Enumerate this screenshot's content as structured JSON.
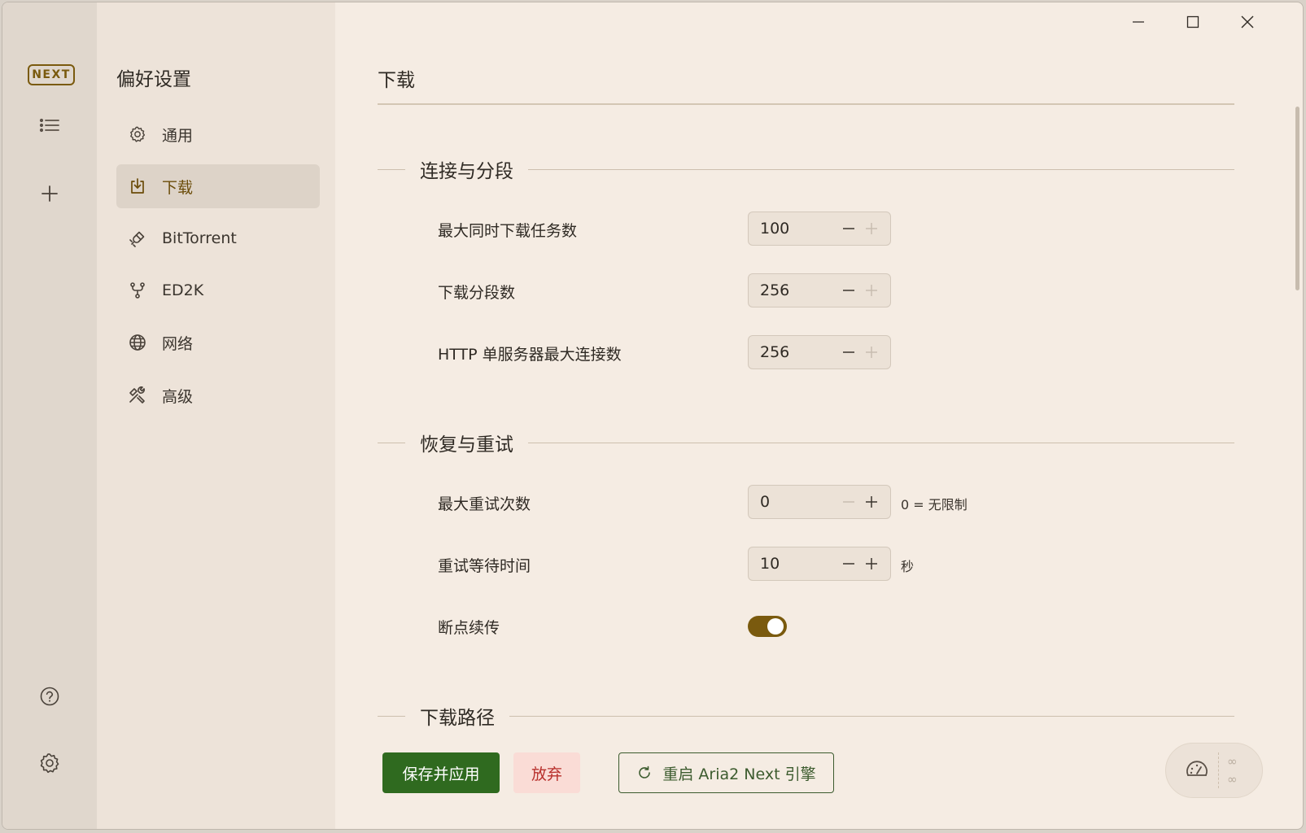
{
  "app": {
    "logo_text": "NEXT",
    "accent_color": "#7a5a0e",
    "primary_color": "#2f6a1f",
    "danger_color": "#b8302c"
  },
  "rail": {
    "icons": [
      "list-icon",
      "plus-icon",
      "help-icon",
      "gear-icon"
    ]
  },
  "sidebar": {
    "title": "偏好设置",
    "items": [
      {
        "label": "通用",
        "icon": "gear-icon",
        "active": false
      },
      {
        "label": "下载",
        "icon": "download-icon",
        "active": true
      },
      {
        "label": "BitTorrent",
        "icon": "magnet-icon",
        "active": false
      },
      {
        "label": "ED2K",
        "icon": "fork-icon",
        "active": false
      },
      {
        "label": "网络",
        "icon": "globe-icon",
        "active": false
      },
      {
        "label": "高级",
        "icon": "tools-icon",
        "active": false
      }
    ]
  },
  "main": {
    "title": "下载",
    "sections": {
      "connection": {
        "title": "连接与分段",
        "max_concurrent": {
          "label": "最大同时下载任务数",
          "value": "100"
        },
        "split": {
          "label": "下载分段数",
          "value": "256"
        },
        "max_conn_per_server": {
          "label": "HTTP 单服务器最大连接数",
          "value": "256"
        }
      },
      "retry": {
        "title": "恢复与重试",
        "max_tries": {
          "label": "最大重试次数",
          "value": "0",
          "suffix": "0 = 无限制"
        },
        "retry_wait": {
          "label": "重试等待时间",
          "value": "10",
          "suffix": "秒"
        },
        "continue": {
          "label": "断点续传",
          "enabled": true
        }
      },
      "path": {
        "title": "下载路径"
      }
    }
  },
  "footer": {
    "save_label": "保存并应用",
    "discard_label": "放弃",
    "restart_label": "重启 Aria2 Next 引擎"
  },
  "speed": {
    "upload": "∞",
    "download": "∞"
  }
}
